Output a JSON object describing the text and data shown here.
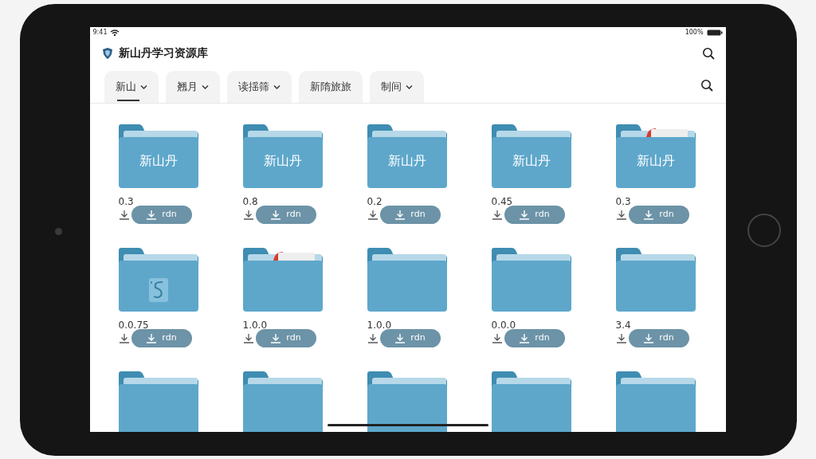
{
  "status_bar": {
    "time": "9:41",
    "battery": "100%"
  },
  "app": {
    "title": "新山丹学习资源库"
  },
  "tabs": [
    {
      "label": "新山",
      "selected": true,
      "dropdown": true
    },
    {
      "label": "翘月",
      "selected": false,
      "dropdown": true
    },
    {
      "label": "读揺筛",
      "selected": false,
      "dropdown": true
    },
    {
      "label": "新隋旅旅",
      "selected": false,
      "dropdown": false
    },
    {
      "label": "制间",
      "selected": false,
      "dropdown": true
    }
  ],
  "folders": [
    {
      "label": "新山丹",
      "version": "0.3",
      "button": "rdn",
      "kind": "plain"
    },
    {
      "label": "新山丹",
      "version": "0.8",
      "button": "rdn",
      "kind": "plain"
    },
    {
      "label": "新山丹",
      "version": "0.2",
      "button": "rdn",
      "kind": "plain"
    },
    {
      "label": "新山丹",
      "version": "0.45",
      "button": "rdn",
      "kind": "plain"
    },
    {
      "label": "新山丹",
      "version": "0.3",
      "button": "rdn",
      "kind": "papers"
    },
    {
      "version": "0.0.75",
      "button": "rdn",
      "kind": "document"
    },
    {
      "version": "1.0.0",
      "button": "rdn",
      "kind": "papers"
    },
    {
      "version": "1.0.0",
      "button": "rdn",
      "kind": "plain"
    },
    {
      "version": "0.0.0",
      "button": "rdn",
      "kind": "plain"
    },
    {
      "version": "3.4",
      "button": "rdn",
      "kind": "plain"
    },
    {
      "kind": "plain"
    },
    {
      "kind": "plain"
    },
    {
      "kind": "plain"
    },
    {
      "kind": "plain"
    },
    {
      "kind": "plain"
    }
  ]
}
